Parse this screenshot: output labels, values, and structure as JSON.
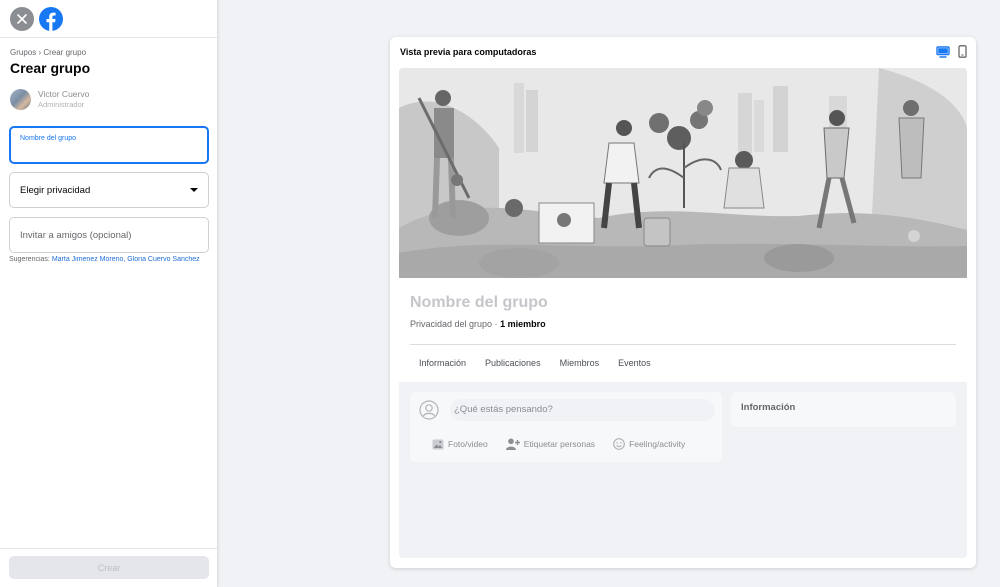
{
  "sidebar": {
    "breadcrumb": "Grupos › Crear grupo",
    "title": "Crear grupo",
    "admin_name": "Victor Cuervo",
    "admin_role": "Administrador",
    "name_field_label": "Nombre del grupo",
    "name_field_value": "",
    "privacy_label": "Elegir privacidad",
    "invite_placeholder": "Invitar a amigos (opcional)",
    "suggestions_label": "Sugerencias:",
    "suggestions_names": "Marta Jimenez Moreno, Gloria Cuervo Sanchez",
    "create_button": "Crear"
  },
  "preview": {
    "title": "Vista previa para computadoras",
    "group_name": "Nombre del grupo",
    "privacy_text": "Privacidad del grupo ·",
    "members_text": "1 miembro",
    "tabs": [
      "Información",
      "Publicaciones",
      "Miembros",
      "Eventos"
    ],
    "composer_prompt": "¿Qué estás pensando?",
    "actions": [
      "Foto/video",
      "Etiquetar personas",
      "Feeling/activity"
    ],
    "info_card_title": "Información"
  },
  "colors": {
    "brand": "#1877f2",
    "link": "#216fdb",
    "background": "#f0f2f5"
  },
  "icons": {
    "close": "close-icon",
    "logo": "facebook-logo",
    "desktop": "desktop-icon",
    "mobile": "mobile-icon"
  }
}
